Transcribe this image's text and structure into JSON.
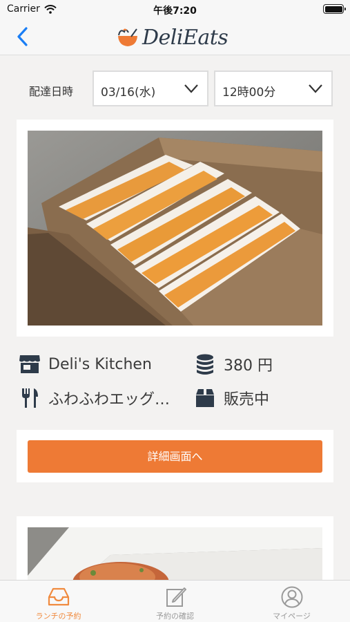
{
  "status_bar": {
    "carrier": "Carrier",
    "time": "午後7:20"
  },
  "nav": {
    "logo_text": "DeliEats"
  },
  "delivery": {
    "label": "配達日時",
    "date_value": "03/16(水)",
    "time_value": "12時00分"
  },
  "item": {
    "shop_name": "Deli's Kitchen",
    "price": "380 円",
    "product_name": "ふわふわエッグサンド",
    "status": "販売中",
    "detail_button": "詳細画面へ"
  },
  "tabs": [
    {
      "label": "ランチの予約",
      "icon": "inbox-icon",
      "active": true
    },
    {
      "label": "予約の確認",
      "icon": "edit-icon",
      "active": false
    },
    {
      "label": "マイページ",
      "icon": "user-icon",
      "active": false
    }
  ],
  "colors": {
    "accent": "#ee7a35",
    "back_blue": "#1a7ef5",
    "icon_navy": "#2e3b4a"
  }
}
